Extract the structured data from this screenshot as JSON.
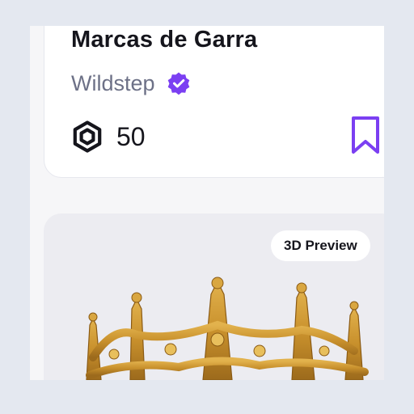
{
  "item": {
    "title": "Marcas de Garra",
    "creator": "Wildstep",
    "creator_verified": true,
    "price": "50",
    "currency_icon": "robux-icon",
    "bookmark_icon": "bookmark-icon"
  },
  "preview": {
    "badge_label": "3D Preview",
    "image": "crown-image"
  },
  "colors": {
    "accent": "#7b3ff2",
    "background": "#f6f6f8",
    "text": "#15151c",
    "muted": "#6d7187"
  }
}
